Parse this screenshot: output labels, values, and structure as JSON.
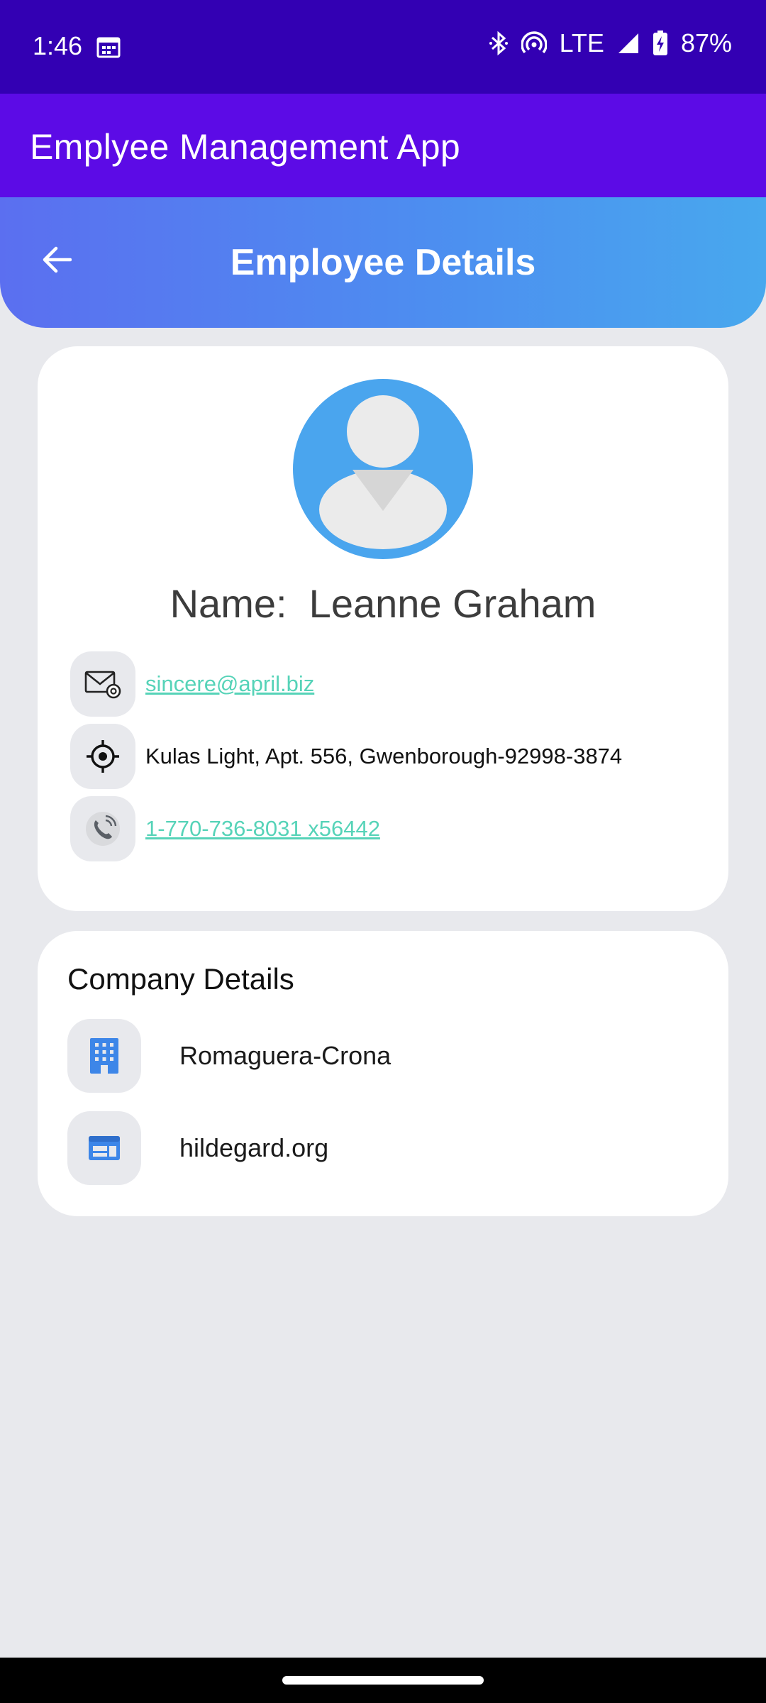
{
  "status_bar": {
    "time": "1:46",
    "network": "LTE",
    "battery": "87%",
    "icons": [
      "calendar-icon",
      "bluetooth-icon",
      "hotspot-icon",
      "signal-icon",
      "battery-charging-icon"
    ]
  },
  "app_bar": {
    "title": "Emplyee Management App"
  },
  "header": {
    "title": "Employee Details",
    "back_icon": "arrow-back-icon"
  },
  "profile": {
    "name_label": "Name:",
    "name": "Leanne Graham",
    "email": "sincere@april.biz",
    "address": "Kulas Light, Apt. 556, Gwenborough-92998-3874",
    "phone": "1-770-736-8031 x56442",
    "icons": [
      "email-icon",
      "location-icon",
      "phone-icon"
    ]
  },
  "company": {
    "title": "Company Details",
    "name": "Romaguera-Crona",
    "website": "hildegard.org",
    "icons": [
      "building-icon",
      "website-icon"
    ]
  },
  "colors": {
    "status_bar": "#3300b3",
    "app_bar": "#5c0be6",
    "header_start": "#5b6ff0",
    "header_end": "#48a8ee",
    "link": "#56d3b8",
    "avatar": "#4aa5ee",
    "background": "#e8e9ed"
  }
}
